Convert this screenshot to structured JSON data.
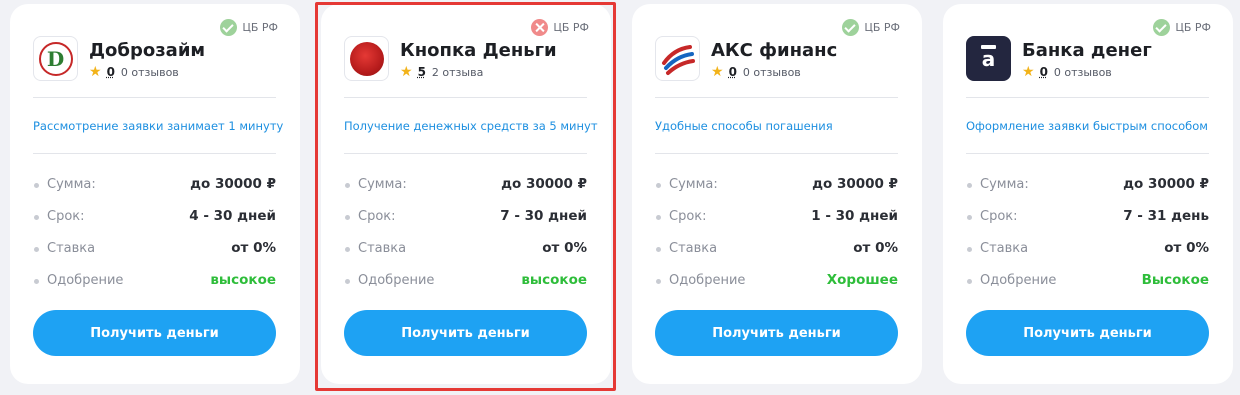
{
  "cards": [
    {
      "name": "Доброзайм",
      "badge": "ЦБ РФ",
      "badge_status": "ok",
      "rating": "0",
      "reviews": "0 отзывов",
      "feature": "Рассмотрение заявки занимает 1 минуту",
      "params": {
        "sum_label": "Сумма:",
        "sum_value": "до 30000 ₽",
        "term_label": "Срок:",
        "term_value": "4 - 30 дней",
        "rate_label": "Ставка",
        "rate_value": "от 0%",
        "approval_label": "Одобрение",
        "approval_value": "высокое"
      },
      "button": "Получить деньги"
    },
    {
      "name": "Кнопка Деньги",
      "badge": "ЦБ РФ",
      "badge_status": "bad",
      "rating": "5",
      "reviews": "2 отзыва",
      "feature": "Получение денежных средств за 5 минут",
      "params": {
        "sum_label": "Сумма:",
        "sum_value": "до 30000 ₽",
        "term_label": "Срок:",
        "term_value": "7 - 30 дней",
        "rate_label": "Ставка",
        "rate_value": "от 0%",
        "approval_label": "Одобрение",
        "approval_value": "высокое"
      },
      "button": "Получить деньги"
    },
    {
      "name": "АКС финанс",
      "badge": "ЦБ РФ",
      "badge_status": "ok",
      "rating": "0",
      "reviews": "0 отзывов",
      "feature": "Удобные способы погашения",
      "params": {
        "sum_label": "Сумма:",
        "sum_value": "до 30000 ₽",
        "term_label": "Срок:",
        "term_value": "1 - 30 дней",
        "rate_label": "Ставка",
        "rate_value": "от 0%",
        "approval_label": "Одобрение",
        "approval_value": "Хорошее"
      },
      "button": "Получить деньги"
    },
    {
      "name": "Банка денег",
      "badge": "ЦБ РФ",
      "badge_status": "ok",
      "rating": "0",
      "reviews": "0 отзывов",
      "feature": "Оформление заявки быстрым способом",
      "params": {
        "sum_label": "Сумма:",
        "sum_value": "до 30000 ₽",
        "term_label": "Срок:",
        "term_value": "7 - 31 день",
        "rate_label": "Ставка",
        "rate_value": "от 0%",
        "approval_label": "Одобрение",
        "approval_value": "Высокое"
      },
      "button": "Получить деньги"
    }
  ],
  "logos": {
    "dobrozaim_letter": "D",
    "banka_letter": "a"
  },
  "colors": {
    "accent": "#1ea2f3",
    "link": "#1d8fe0",
    "approval_green": "#2ebd3a",
    "highlight_border": "#e53935"
  }
}
